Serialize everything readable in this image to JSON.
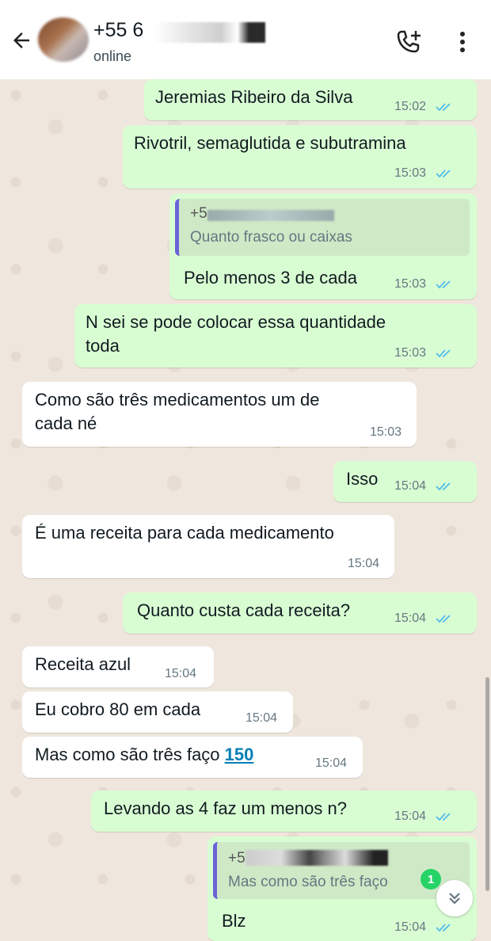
{
  "header": {
    "contact_name": "+55 6",
    "status": "online"
  },
  "icons": {
    "back": "arrow-left-icon",
    "call": "add-call-icon",
    "menu": "more-vertical-icon",
    "read": "double-check-icon",
    "scroll": "double-chevron-down-icon"
  },
  "colors": {
    "outgoing_bubble": "#d9fdd3",
    "incoming_bubble": "#ffffff",
    "read_ticks": "#53bdeb",
    "quote_bar": "#6b63d6",
    "link": "#027eb5",
    "unread_badge": "#25d366"
  },
  "messages": [
    {
      "text": "Jeremias Ribeiro da Silva",
      "time": "15:02",
      "direction": "out"
    },
    {
      "text": "Rivotril, semaglutida e subutramina",
      "time": "15:03",
      "direction": "out"
    },
    {
      "quote_sender": "+5",
      "quote_text": "Quanto frasco ou caixas",
      "text": "Pelo menos 3 de cada",
      "time": "15:03",
      "direction": "out"
    },
    {
      "text_line1": "N sei se pode colocar essa quantidade",
      "text_line2": "toda",
      "time": "15:03",
      "direction": "out"
    },
    {
      "text_line1": "Como são três medicamentos um de",
      "text_line2": "cada né",
      "time": "15:03",
      "direction": "in"
    },
    {
      "text": "Isso",
      "time": "15:04",
      "direction": "out"
    },
    {
      "text": "É uma receita para cada medicamento",
      "time": "15:04",
      "direction": "in"
    },
    {
      "text": "Quanto custa cada receita?",
      "time": "15:04",
      "direction": "out"
    },
    {
      "text": "Receita azul",
      "time": "15:04",
      "direction": "in"
    },
    {
      "text": "Eu cobro 80 em cada",
      "time": "15:04",
      "direction": "in"
    },
    {
      "text": "Mas como são três faço ",
      "link": "150",
      "time": "15:04",
      "direction": "in"
    },
    {
      "text": "Levando as 4 faz um menos n?",
      "time": "15:04",
      "direction": "out"
    },
    {
      "quote_sender": "+5",
      "quote_text": "Mas como são três faço",
      "text": "Blz",
      "time": "15:04",
      "direction": "out"
    }
  ],
  "unread_count": "1"
}
